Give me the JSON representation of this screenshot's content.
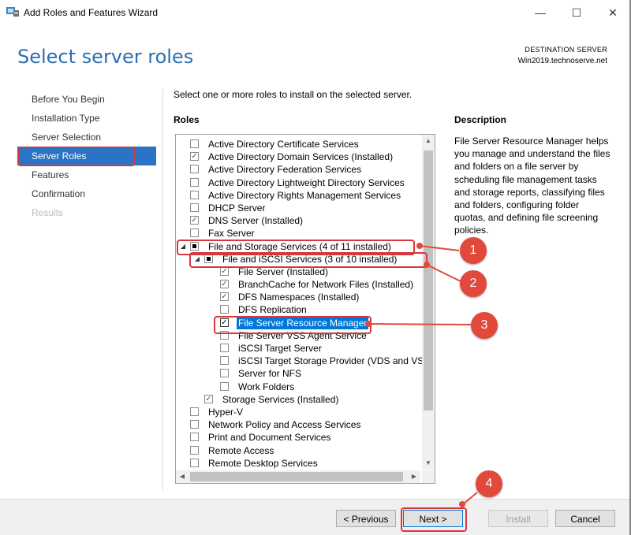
{
  "window": {
    "title": "Add Roles and Features Wizard",
    "icons": {
      "app": "server-manager-icon",
      "minimize": "minimize-icon",
      "maximize": "maximize-icon",
      "close": "close-icon"
    }
  },
  "page": {
    "heading": "Select server roles"
  },
  "destination": {
    "label": "DESTINATION SERVER",
    "server": "Win2019.technoserve.net"
  },
  "nav": {
    "items": [
      {
        "label": "Before You Begin",
        "state": "normal"
      },
      {
        "label": "Installation Type",
        "state": "normal"
      },
      {
        "label": "Server Selection",
        "state": "normal"
      },
      {
        "label": "Server Roles",
        "state": "active"
      },
      {
        "label": "Features",
        "state": "normal"
      },
      {
        "label": "Confirmation",
        "state": "normal"
      },
      {
        "label": "Results",
        "state": "disabled"
      }
    ]
  },
  "main": {
    "intro": "Select one or more roles to install on the selected server.",
    "roles_label": "Roles",
    "description_label": "Description",
    "description": "File Server Resource Manager helps you manage and understand the files and folders on a file server by scheduling file management tasks and storage reports, classifying files and folders, configuring folder quotas, and defining file screening policies."
  },
  "roles": [
    {
      "label": "Active Directory Certificate Services",
      "level": 0,
      "check": "none"
    },
    {
      "label": "Active Directory Domain Services (Installed)",
      "level": 0,
      "check": "installed"
    },
    {
      "label": "Active Directory Federation Services",
      "level": 0,
      "check": "none"
    },
    {
      "label": "Active Directory Lightweight Directory Services",
      "level": 0,
      "check": "none"
    },
    {
      "label": "Active Directory Rights Management Services",
      "level": 0,
      "check": "none"
    },
    {
      "label": "DHCP Server",
      "level": 0,
      "check": "none"
    },
    {
      "label": "DNS Server (Installed)",
      "level": 0,
      "check": "installed"
    },
    {
      "label": "Fax Server",
      "level": 0,
      "check": "none"
    },
    {
      "label": "File and Storage Services (4 of 11 installed)",
      "level": 0,
      "check": "partial",
      "expander": true
    },
    {
      "label": "File and iSCSI Services (3 of 10 installed)",
      "level": 1,
      "check": "partial",
      "expander": true
    },
    {
      "label": "File Server (Installed)",
      "level": 2,
      "check": "installed"
    },
    {
      "label": "BranchCache for Network Files (Installed)",
      "level": 2,
      "check": "installed"
    },
    {
      "label": "DFS Namespaces (Installed)",
      "level": 2,
      "check": "installed"
    },
    {
      "label": "DFS Replication",
      "level": 2,
      "check": "none"
    },
    {
      "label": "File Server Resource Manager",
      "level": 2,
      "check": "checked",
      "selected": true
    },
    {
      "label": "File Server VSS Agent Service",
      "level": 2,
      "check": "none"
    },
    {
      "label": "iSCSI Target Server",
      "level": 2,
      "check": "none"
    },
    {
      "label": "iSCSI Target Storage Provider (VDS and VSS",
      "level": 2,
      "check": "none"
    },
    {
      "label": "Server for NFS",
      "level": 2,
      "check": "none"
    },
    {
      "label": "Work Folders",
      "level": 2,
      "check": "none"
    },
    {
      "label": "Storage Services (Installed)",
      "level": 1,
      "check": "installed"
    },
    {
      "label": "Hyper-V",
      "level": 0,
      "check": "none"
    },
    {
      "label": "Network Policy and Access Services",
      "level": 0,
      "check": "none"
    },
    {
      "label": "Print and Document Services",
      "level": 0,
      "check": "none"
    },
    {
      "label": "Remote Access",
      "level": 0,
      "check": "none"
    },
    {
      "label": "Remote Desktop Services",
      "level": 0,
      "check": "none"
    }
  ],
  "buttons": {
    "previous": "< Previous",
    "next": "Next >",
    "install": "Install",
    "cancel": "Cancel"
  },
  "callouts": [
    "1",
    "2",
    "3",
    "4"
  ],
  "colors": {
    "heading": "#2b6fb0",
    "nav_active": "#2b73c4",
    "annotation": "#e2483c",
    "selection": "#0078d7"
  }
}
